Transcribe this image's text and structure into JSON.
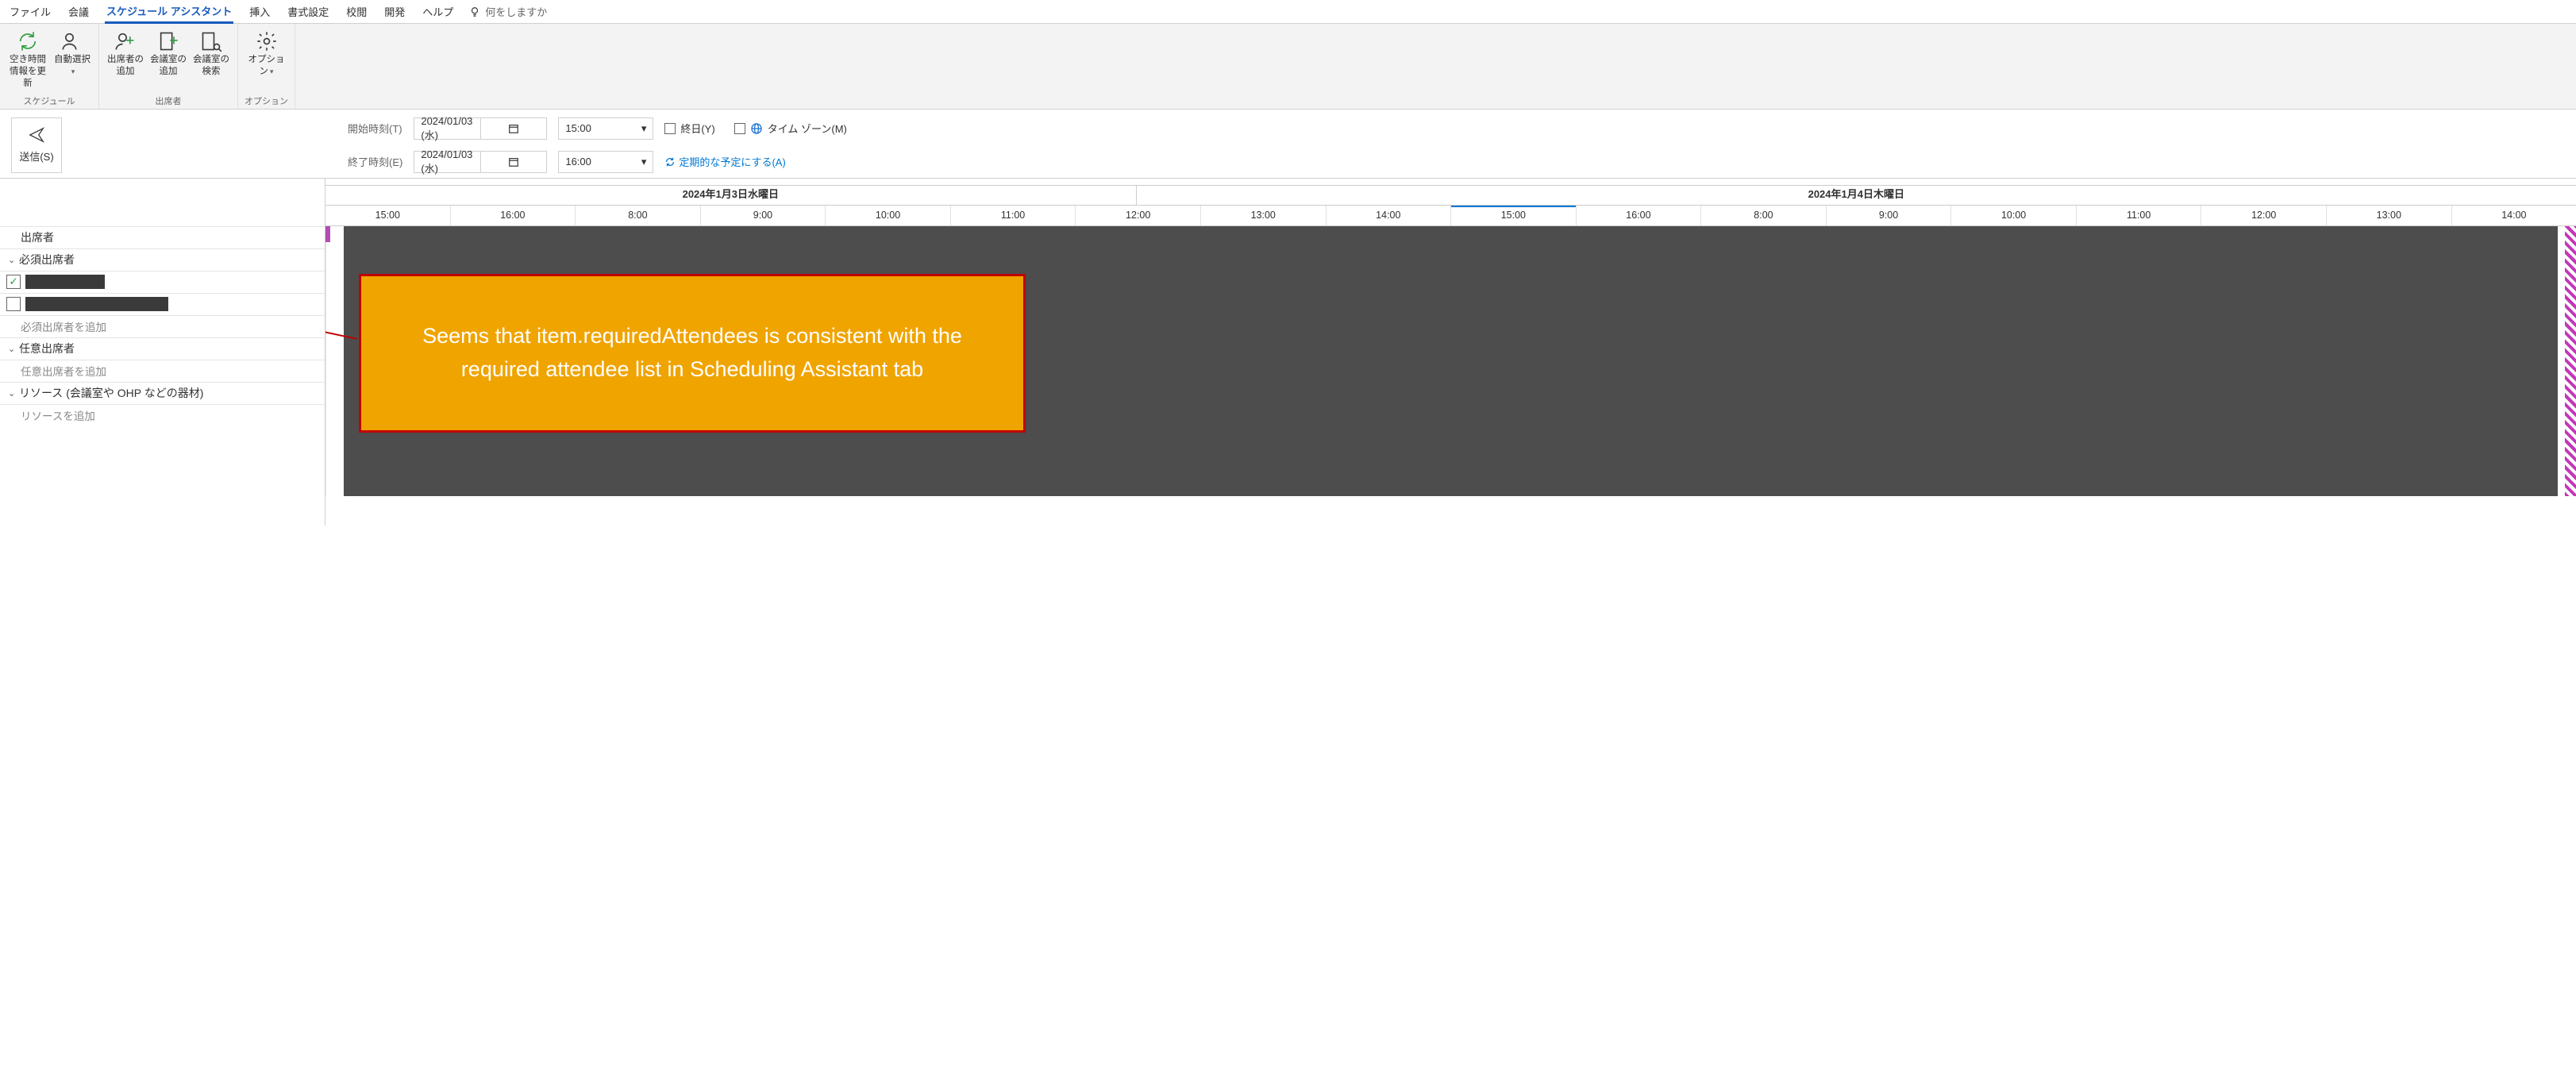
{
  "tabs": {
    "file": "ファイル",
    "meeting": "会議",
    "schedassist": "スケジュール アシスタント",
    "insert": "挿入",
    "format": "書式設定",
    "review": "校閲",
    "developer": "開発",
    "help": "ヘルプ",
    "tellme": "何をしますか"
  },
  "ribbon": {
    "group_schedule": "スケジュール",
    "group_attendees": "出席者",
    "group_options": "オプション",
    "refresh": "空き時間情報を更新",
    "autopick": "自動選択",
    "add_attendee": "出席者の追加",
    "add_room": "会議室の追加",
    "find_room": "会議室の検索",
    "options": "オプション"
  },
  "send": "送信(S)",
  "time": {
    "start_label": "開始時刻(T)",
    "end_label": "終了時刻(E)",
    "start_date": "2024/01/03 (水)",
    "end_date": "2024/01/03 (水)",
    "start_time": "15:00",
    "end_time": "16:00",
    "allday": "終日(Y)",
    "timezones": "タイム ゾーン(M)",
    "recur": "定期的な予定にする(A)"
  },
  "attendee_panel": {
    "header": "出席者",
    "required": "必須出席者",
    "required_add": "必須出席者を追加",
    "optional": "任意出席者",
    "optional_add": "任意出席者を追加",
    "resources": "リソース (会議室や OHP などの器材)",
    "resources_add": "リソースを追加"
  },
  "scheduler": {
    "day1": "2024年1月3日水曜日",
    "day2": "2024年1月4日木曜日",
    "hours": [
      "15:00",
      "16:00",
      "8:00",
      "9:00",
      "10:00",
      "11:00",
      "12:00",
      "13:00",
      "14:00",
      "15:00",
      "16:00",
      "8:00",
      "9:00",
      "10:00",
      "11:00",
      "12:00",
      "13:00",
      "14:00"
    ]
  },
  "callout": {
    "text": "Seems that  item.requiredAttendees is consistent with the required attendee list in Scheduling Assistant tab"
  }
}
